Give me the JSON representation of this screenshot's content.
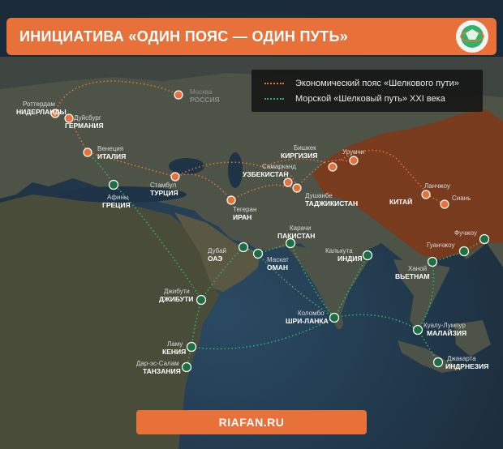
{
  "header": {
    "title": "ИНИЦИАТИВА «ОДИН ПОЯС — ОДИН ПУТЬ»"
  },
  "legend": {
    "economic_belt": "Экономический пояс «Шелкового пути»",
    "maritime_road": "Морской «Шелковый путь» XXI века"
  },
  "colors": {
    "accent": "#e8713a",
    "land_route": "#e8713a",
    "sea_route": "#2fb36a",
    "china_fill": "#7a3a1c"
  },
  "footer": {
    "site": "RIAFAN.RU"
  },
  "cities": [
    {
      "id": "rotterdam",
      "city": "Роттердам",
      "country": "НИДЕРЛАНДЫ",
      "route": "land"
    },
    {
      "id": "duisburg",
      "city": "Дуйсбург",
      "country": "ГЕРМАНИЯ",
      "route": "land"
    },
    {
      "id": "moscow",
      "city": "Москва",
      "country": "РОССИЯ",
      "route": "land"
    },
    {
      "id": "venice",
      "city": "Венеция",
      "country": "ИТАЛИЯ",
      "route": "land"
    },
    {
      "id": "istanbul",
      "city": "Стамбул",
      "country": "ТУРЦИЯ",
      "route": "land"
    },
    {
      "id": "athens",
      "city": "Афины",
      "country": "ГРЕЦИЯ",
      "route": "sea"
    },
    {
      "id": "tehran",
      "city": "Тегеран",
      "country": "ИРАН",
      "route": "land"
    },
    {
      "id": "bishkek",
      "city": "Бишкек",
      "country": "КИРГИЗИЯ",
      "route": "land"
    },
    {
      "id": "samarkand",
      "city": "Самарканд",
      "country": "УЗБЕКИСТАН",
      "route": "land"
    },
    {
      "id": "dushanbe",
      "city": "Душанбе",
      "country": "ТАДЖИКИСТАН",
      "route": "land"
    },
    {
      "id": "urumqi",
      "city": "Урумчи",
      "country": "",
      "route": "land"
    },
    {
      "id": "lanzhou",
      "city": "Ланчжоу",
      "country": "",
      "route": "land"
    },
    {
      "id": "xian",
      "city": "Сиань",
      "country": "",
      "route": "land"
    },
    {
      "id": "china",
      "city": "",
      "country": "КИТАЙ",
      "route": "land"
    },
    {
      "id": "fuzhou",
      "city": "Фучжоу",
      "country": "",
      "route": "sea"
    },
    {
      "id": "guangzhou",
      "city": "Гуанчжоу",
      "country": "",
      "route": "sea"
    },
    {
      "id": "hanoi",
      "city": "Ханой",
      "country": "ВЬЕТНАМ",
      "route": "sea"
    },
    {
      "id": "karachi",
      "city": "Карачи",
      "country": "ПАКИСТАН",
      "route": "sea"
    },
    {
      "id": "dubai",
      "city": "Дубай",
      "country": "ОАЭ",
      "route": "sea"
    },
    {
      "id": "muscat",
      "city": "Маскат",
      "country": "ОМАН",
      "route": "sea"
    },
    {
      "id": "kolkata",
      "city": "Калькута",
      "country": "ИНДИЯ",
      "route": "sea"
    },
    {
      "id": "colombo",
      "city": "Коломбо",
      "country": "ШРИ-ЛАНКА",
      "route": "sea"
    },
    {
      "id": "kualalumpur",
      "city": "Куалу-Лумпур",
      "country": "МАЛАЙЗИЯ",
      "route": "sea"
    },
    {
      "id": "jakarta",
      "city": "Джакарта",
      "country": "ИНДРНЕЗИЯ",
      "route": "sea"
    },
    {
      "id": "djibouti",
      "city": "Джибути",
      "country": "ДЖИБУТИ",
      "route": "sea"
    },
    {
      "id": "lamu",
      "city": "Ламу",
      "country": "КЕНИЯ",
      "route": "sea"
    },
    {
      "id": "dar",
      "city": "Дар-эс-Салам",
      "country": "ТАНЗАНИЯ",
      "route": "sea"
    }
  ]
}
